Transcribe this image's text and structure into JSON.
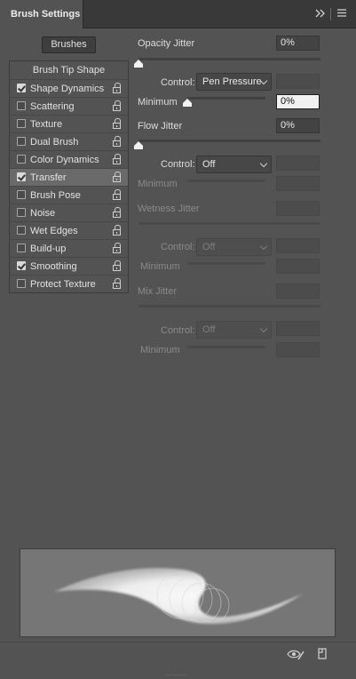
{
  "header": {
    "tab_title": "Brush Settings",
    "expand_icon": "double-chevron-right-icon",
    "menu_icon": "hamburger-menu-icon"
  },
  "brushes_button": {
    "label": "Brushes"
  },
  "sidebar": {
    "header": "Brush Tip Shape",
    "items": [
      {
        "label": "Shape Dynamics",
        "checked": true,
        "selected": false
      },
      {
        "label": "Scattering",
        "checked": false,
        "selected": false
      },
      {
        "label": "Texture",
        "checked": false,
        "selected": false
      },
      {
        "label": "Dual Brush",
        "checked": false,
        "selected": false
      },
      {
        "label": "Color Dynamics",
        "checked": false,
        "selected": false
      },
      {
        "label": "Transfer",
        "checked": true,
        "selected": true
      },
      {
        "label": "Brush Pose",
        "checked": false,
        "selected": false
      },
      {
        "label": "Noise",
        "checked": false,
        "selected": false
      },
      {
        "label": "Wet Edges",
        "checked": false,
        "selected": false
      },
      {
        "label": "Build-up",
        "checked": false,
        "selected": false
      },
      {
        "label": "Smoothing",
        "checked": true,
        "selected": false
      },
      {
        "label": "Protect Texture",
        "checked": false,
        "selected": false
      }
    ]
  },
  "transfer": {
    "opacity_jitter": {
      "label": "Opacity Jitter",
      "value": "0%"
    },
    "opacity_control": {
      "label": "Control:",
      "value": "Pen Pressure"
    },
    "opacity_minimum": {
      "label": "Minimum",
      "value": "0%"
    },
    "flow_jitter": {
      "label": "Flow Jitter",
      "value": "0%"
    },
    "flow_control": {
      "label": "Control:",
      "value": "Off"
    },
    "flow_minimum": {
      "label": "Minimum"
    },
    "wetness_jitter": {
      "label": "Wetness Jitter"
    },
    "wetness_control": {
      "label": "Control:",
      "value": "Off"
    },
    "wetness_minimum": {
      "label": "Minimum"
    },
    "mix_jitter": {
      "label": "Mix Jitter"
    },
    "mix_control": {
      "label": "Control:",
      "value": "Off"
    },
    "mix_minimum": {
      "label": "Minimum"
    }
  },
  "footer": {
    "preview_toggle_icon": "eye-brush-icon",
    "new_preset_icon": "new-document-icon"
  },
  "colors": {
    "panel_bg": "#535353",
    "header_bg": "#393939",
    "selected_row": "#6a6a6a"
  }
}
